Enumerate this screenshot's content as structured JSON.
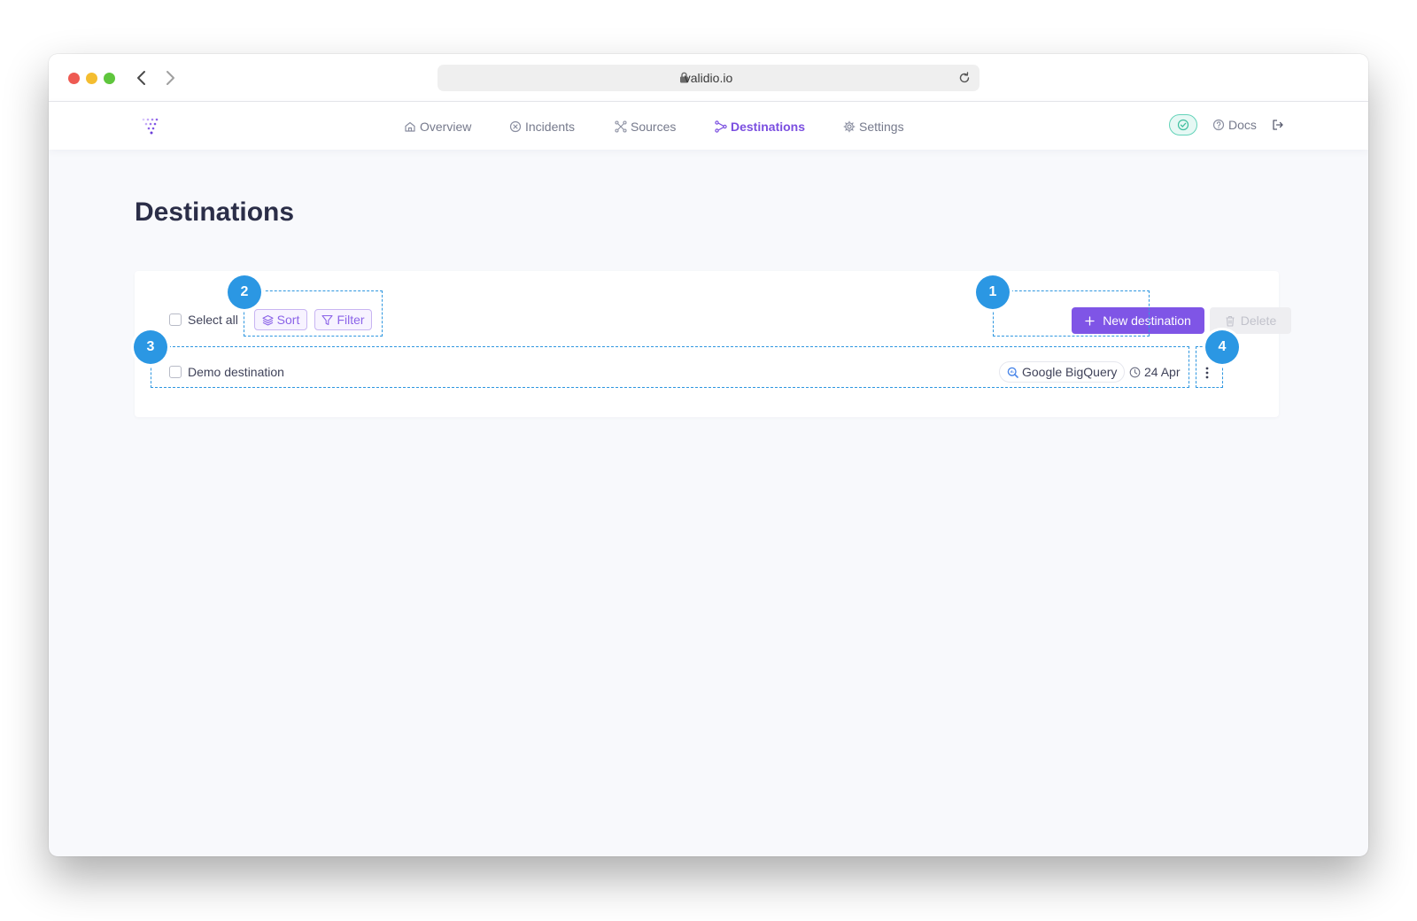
{
  "browser": {
    "url": "validio.io"
  },
  "nav": {
    "items": [
      {
        "label": "Overview",
        "icon": "home-icon"
      },
      {
        "label": "Incidents",
        "icon": "x-circle-icon"
      },
      {
        "label": "Sources",
        "icon": "nodes-icon"
      },
      {
        "label": "Destinations",
        "icon": "branch-icon",
        "active": true
      },
      {
        "label": "Settings",
        "icon": "gear-icon"
      }
    ],
    "docs_label": "Docs"
  },
  "page": {
    "title": "Destinations"
  },
  "toolbar": {
    "select_all_label": "Select all",
    "sort_label": "Sort",
    "filter_label": "Filter",
    "new_button_label": "New destination",
    "delete_button_label": "Delete"
  },
  "rows": [
    {
      "name": "Demo destination",
      "type": "Google BigQuery",
      "date": "24 Apr"
    }
  ],
  "annotations": [
    "1",
    "2",
    "3",
    "4"
  ],
  "colors": {
    "accent": "#7f55e6",
    "callout": "#2b97e3",
    "status_ok": "#63d3b9"
  }
}
